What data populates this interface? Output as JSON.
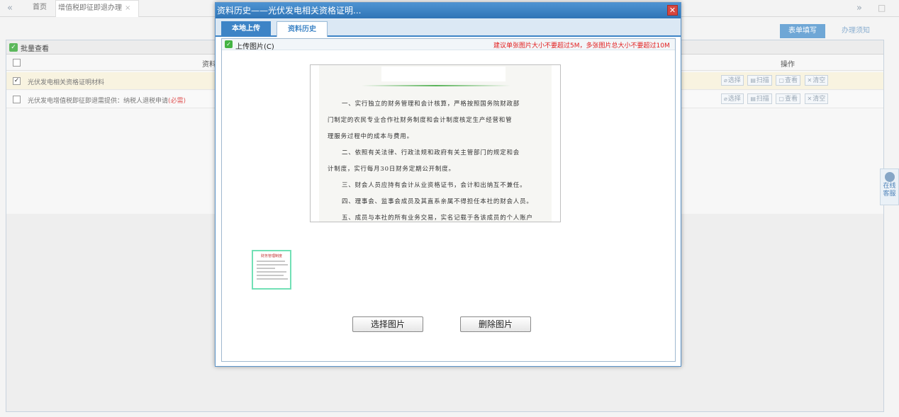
{
  "topbar": {
    "prev_icon": "«",
    "home_tab": "首页",
    "current_tab": "增值税即征即退办理",
    "close_icon": "×",
    "next_icon": "»",
    "window_icon": "□"
  },
  "subbar": {
    "form_button": "表单填写",
    "guide_button": "办理须知"
  },
  "batch": {
    "label": "批量查看"
  },
  "grid": {
    "material_header": "资料",
    "ops_header": "操作",
    "rows": [
      {
        "name": "光伏发电相关资格证明材料",
        "checked": "✓",
        "required": ""
      },
      {
        "name": "光伏发电增值税即征即退需提供：纳税人退税申请",
        "checked": "",
        "required": "(必需)"
      }
    ],
    "ops": [
      "选择",
      "扫描",
      "查看",
      "清空"
    ]
  },
  "service_widget": {
    "line1": "在线",
    "line2": "客服"
  },
  "modal": {
    "title": "资料历史——光伏发电相关资格证明...",
    "close_icon": "✕",
    "tab_local": "本地上传",
    "tab_history": "资料历史",
    "upload_label": "上传图片(C)",
    "upload_note": "建议单张图片大小不要超过5M，多张图片总大小不要超过10M",
    "document_lines": [
      "一、实行独立的财务管理和会计核算，严格按照国务院财政部",
      "门制定的农民专业合作社财务制度和会计制度核定生产经营和管",
      "理服务过程中的成本与费用。",
      "二、依照有关法律、行政法规和政府有关主管部门的规定和会",
      "计制度，实行每月30日财务定期公开制度。",
      "三、财会人员应持有会计从业资格证书，会计和出纳互不兼任。",
      "四、理事会、监事会成员及其直系亲属不得担任本社的财会人员。",
      "五、成员与本社的所有业务交易，实名记载于各该成员的个人账户"
    ],
    "thumbnail_title": "财务管理制度",
    "select_button": "选择图片",
    "delete_button": "删除图片"
  },
  "colors": {
    "accent": "#3d84c6",
    "warning": "#e21c1c",
    "success": "#44b344"
  }
}
